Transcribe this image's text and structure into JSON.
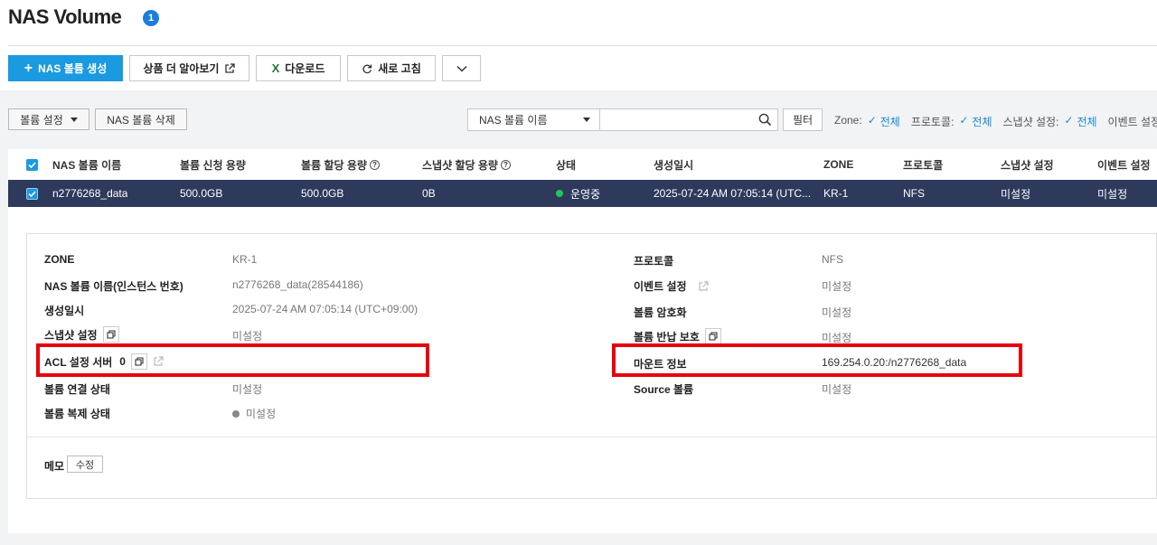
{
  "page": {
    "title": "NAS Volume",
    "count_badge": "1"
  },
  "toolbar": {
    "create_label": "NAS 볼륨 생성",
    "learn_more_label": "상품 더 알아보기",
    "download_label": "다운로드",
    "refresh_label": "새로 고침"
  },
  "actions": {
    "volume_settings_label": "볼륨 설정",
    "delete_label": "NAS 볼륨 삭제"
  },
  "search": {
    "field_select": "NAS 볼륨 이름",
    "query": ""
  },
  "filter": {
    "button_label": "필터",
    "items": [
      {
        "key": "Zone:",
        "value": "전체"
      },
      {
        "key": "프로토콜:",
        "value": "전체"
      },
      {
        "key": "스냅샷 설정:",
        "value": "전체"
      },
      {
        "key": "이벤트 설정:",
        "value": ""
      }
    ]
  },
  "table": {
    "columns": [
      "NAS 볼륨 이름",
      "볼륨 신청 용량",
      "볼륨 할당 용량",
      "스냅샷 할당 용량",
      "상태",
      "생성일시",
      "ZONE",
      "프로토콜",
      "스냅샷 설정",
      "이벤트 설정"
    ],
    "rows": [
      {
        "name": "n2776268_data",
        "requested": "500.0GB",
        "allocated": "500.0GB",
        "snapshot_allocated": "0B",
        "status": "운영중",
        "created": "2025-07-24 AM 07:05:14 (UTC...",
        "zone": "KR-1",
        "protocol": "NFS",
        "snapshot_setting": "미설정",
        "event_setting": "미설정"
      }
    ]
  },
  "detail": {
    "left": [
      {
        "label": "ZONE",
        "value": "KR-1"
      },
      {
        "label": "NAS 볼륨 이름(인스턴스 번호)",
        "value": "n2776268_data(28544186)"
      },
      {
        "label": "생성일시",
        "value": "2025-07-24 AM 07:05:14 (UTC+09:00)"
      },
      {
        "label": "스냅샷 설정",
        "value": "미설정"
      },
      {
        "label": "ACL 설정 서버",
        "count": "0",
        "value": ""
      },
      {
        "label": "볼륨 연결 상태",
        "value": "미설정"
      },
      {
        "label": "볼륨 복제 상태",
        "value": "미설정"
      }
    ],
    "right": [
      {
        "label": "프로토콜",
        "value": "NFS"
      },
      {
        "label": "이벤트 설정",
        "value": "미설정"
      },
      {
        "label": "볼륨 암호화",
        "value": "미설정"
      },
      {
        "label": "볼륨 반납 보호",
        "value": "미설정"
      },
      {
        "label": "마운트 정보",
        "value": "169.254.0.20:/n2776268_data"
      },
      {
        "label": "Source 볼륨",
        "value": "미설정"
      }
    ],
    "memo_label": "메모",
    "memo_edit_label": "수정"
  },
  "colors": {
    "accent": "#1a9ae0",
    "selected_row": "#2e3a5c",
    "highlight": "#e8000b",
    "status_ok": "#21c45a"
  }
}
